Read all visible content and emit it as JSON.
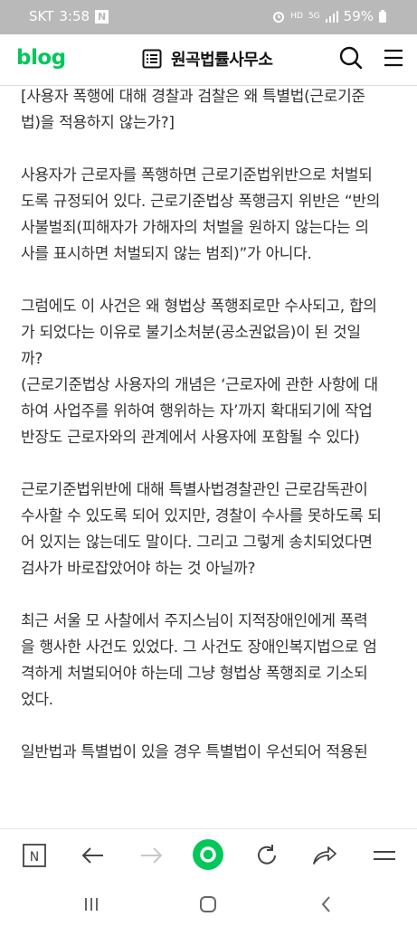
{
  "status_bar": {
    "carrier": "SKT",
    "time": "3:58",
    "network": "5G",
    "battery": "59%"
  },
  "header": {
    "logo": "blog",
    "blog_name": "원곡법률사무소"
  },
  "article": {
    "paragraphs": [
      "[사용자 폭행에 대해 경찰과 검찰은 왜 특별법(근로기준\n법)을 적용하지 않는가?]",
      "사용자가 근로자를 폭행하면 근로기준법위반으로 처벌되\n도록 규정되어 있다. 근로기준법상 폭행금지 위반은 “반의\n사불벌죄(피해자가 가해자의 처벌을 원하지 않는다는 의\n사를 표시하면 처벌되지 않는 범죄)”가 아니다.",
      "그럼에도 이 사건은 왜 형법상 폭행죄로만 수사되고, 합의\n가 되었다는 이유로 불기소처분(공소권없음)이 된 것일\n까?\n(근로기준법상 사용자의 개념은 ‘근로자에 관한 사항에 대\n하여 사업주를 위하여 행위하는 자’까지 확대되기에 작업\n반장도 근로자와의 관계에서 사용자에 포함될 수 있다)",
      "근로기준법위반에 대해 특별사법경찰관인 근로감독관이\n수사할 수 있도록 되어 있지만, 경찰이 수사를 못하도록 되\n어 있지는 않는데도 말이다. 그리고 그렇게 송치되었다면\n검사가 바로잡았어야 하는 것 아닐까?",
      "최근 서울 모 사찰에서 주지스님이 지적장애인에게 폭력\n을 행사한 사건도 있었다. 그 사건도 장애인복지법으로 엄\n격하게 처벌되어야 하는데 그냥 형법상 폭행죄로 기소되\n었다.",
      "일반법과 특별법이 있을 경우 특별법이 우선되어 적용된"
    ]
  },
  "colors": {
    "brand": "#03c75a",
    "status_bar_bg": "#b9b9b9",
    "text": "#333333"
  },
  "toolbar_icons": [
    "naver-icon",
    "back-arrow-icon",
    "forward-arrow-icon",
    "green-dot-icon",
    "refresh-icon",
    "share-icon",
    "menu-icon"
  ],
  "nav_icons": [
    "recent-apps-icon",
    "home-icon",
    "back-icon"
  ]
}
